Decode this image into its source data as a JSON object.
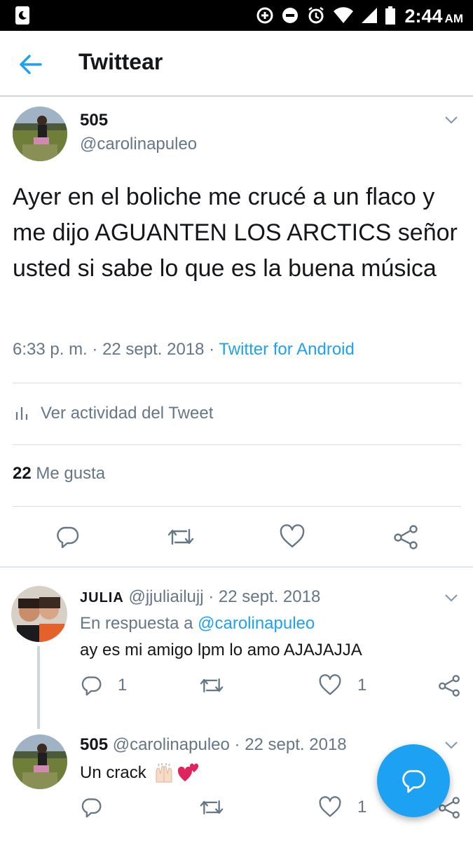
{
  "status_bar": {
    "time": "2:44",
    "ampm": "AM",
    "icons": [
      "data-saver-icon",
      "do-not-disturb-icon",
      "alarm-icon",
      "wifi-icon",
      "signal-icon",
      "battery-icon"
    ]
  },
  "app_bar": {
    "title": "Twittear",
    "back_icon": "arrow-left-icon"
  },
  "tweet": {
    "name": "505",
    "handle": "@carolinapuleo",
    "text": "Ayer en el boliche me crucé a un flaco y me dijo AGUANTEN LOS ARCTICS señor usted si sabe lo que es la buena música",
    "time": "6:33 p. m.",
    "sep": " · ",
    "date": "22 sept. 2018",
    "source": "Twitter for Android",
    "activity_label": "Ver actividad del Tweet",
    "likes_count": "22",
    "likes_label": "Me gusta"
  },
  "replies": [
    {
      "name": "JULIA",
      "handle": "@jjuliailujj",
      "sep": " · ",
      "date": "22 sept. 2018",
      "reply_prefix": "En respuesta a ",
      "reply_to": "@carolinapuleo",
      "text": "ay es mi amigo lpm lo amo AJAJAJJA",
      "reply_count": "1",
      "like_count": "1"
    },
    {
      "name": "505",
      "handle": "@carolinapuleo",
      "sep": " · ",
      "date": "22 sept. 2018",
      "text": "Un crack",
      "like_count": "1"
    }
  ],
  "colors": {
    "accent": "#1da1f2",
    "text": "#14171a",
    "secondary": "#657786",
    "divider": "#e1e8ed"
  }
}
